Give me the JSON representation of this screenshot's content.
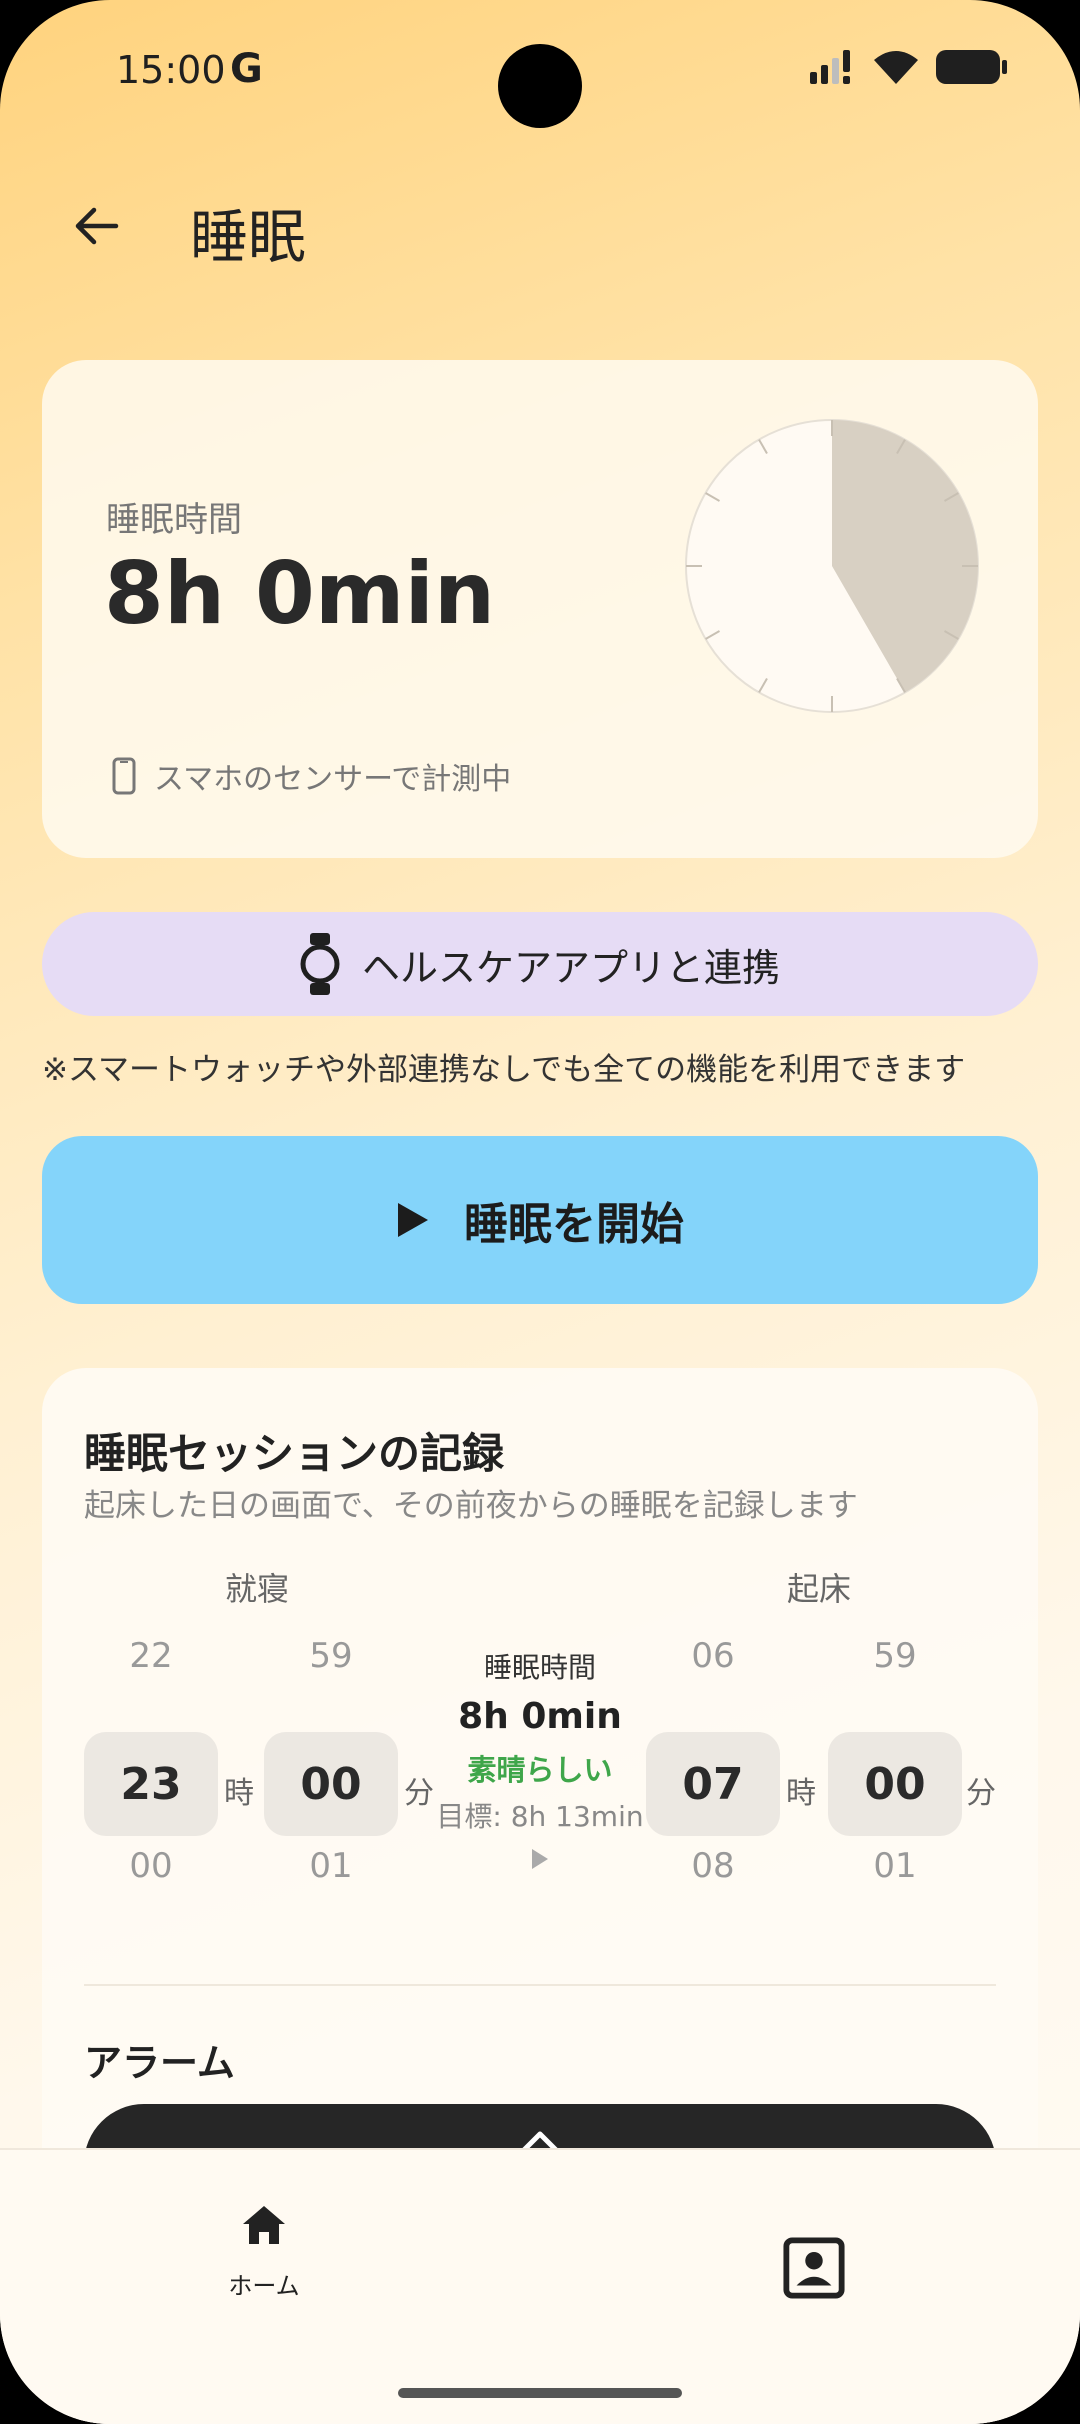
{
  "status_bar": {
    "time": "15:00",
    "g_logo": "G"
  },
  "header": {
    "title": "睡眠"
  },
  "sleep_card": {
    "label": "睡眠時間",
    "value": "8h 0min",
    "sensor_text": "スマホのセンサーで計測中"
  },
  "health_link": {
    "label": "ヘルスケアアプリと連携"
  },
  "note": "※スマートウォッチや外部連携なしでも全ての機能を利用できます",
  "start_button": {
    "label": "睡眠を開始"
  },
  "record": {
    "title": "睡眠セッションの記録",
    "subtitle": "起床した日の画面で、その前夜からの睡眠を記録します",
    "bedtime_label": "就寝",
    "wake_label": "起床",
    "bed_hour": {
      "prev": "22",
      "value": "23",
      "next": "00",
      "unit": "時"
    },
    "bed_minute": {
      "prev": "59",
      "value": "00",
      "next": "01",
      "unit": "分"
    },
    "wake_hour": {
      "prev": "06",
      "value": "07",
      "next": "08",
      "unit": "時"
    },
    "wake_minute": {
      "prev": "59",
      "value": "00",
      "next": "01",
      "unit": "分"
    },
    "duration_label": "睡眠時間",
    "duration_value": "8h 0min",
    "rating": "素晴らしい",
    "goal": "目標: 8h 13min"
  },
  "alarm": {
    "title": "アラーム"
  },
  "bottom_nav": {
    "home_label": "ホーム"
  },
  "colors": {
    "start_button": "#84d4fa",
    "health_button": "#e6dcf5",
    "rating_green": "#3fa64a",
    "alarm_bar": "#262626"
  },
  "icons": [
    "back-arrow-icon",
    "phone-icon",
    "watch-icon",
    "play-icon",
    "home-icon",
    "profile-icon",
    "signal-icon",
    "wifi-icon",
    "battery-icon"
  ]
}
